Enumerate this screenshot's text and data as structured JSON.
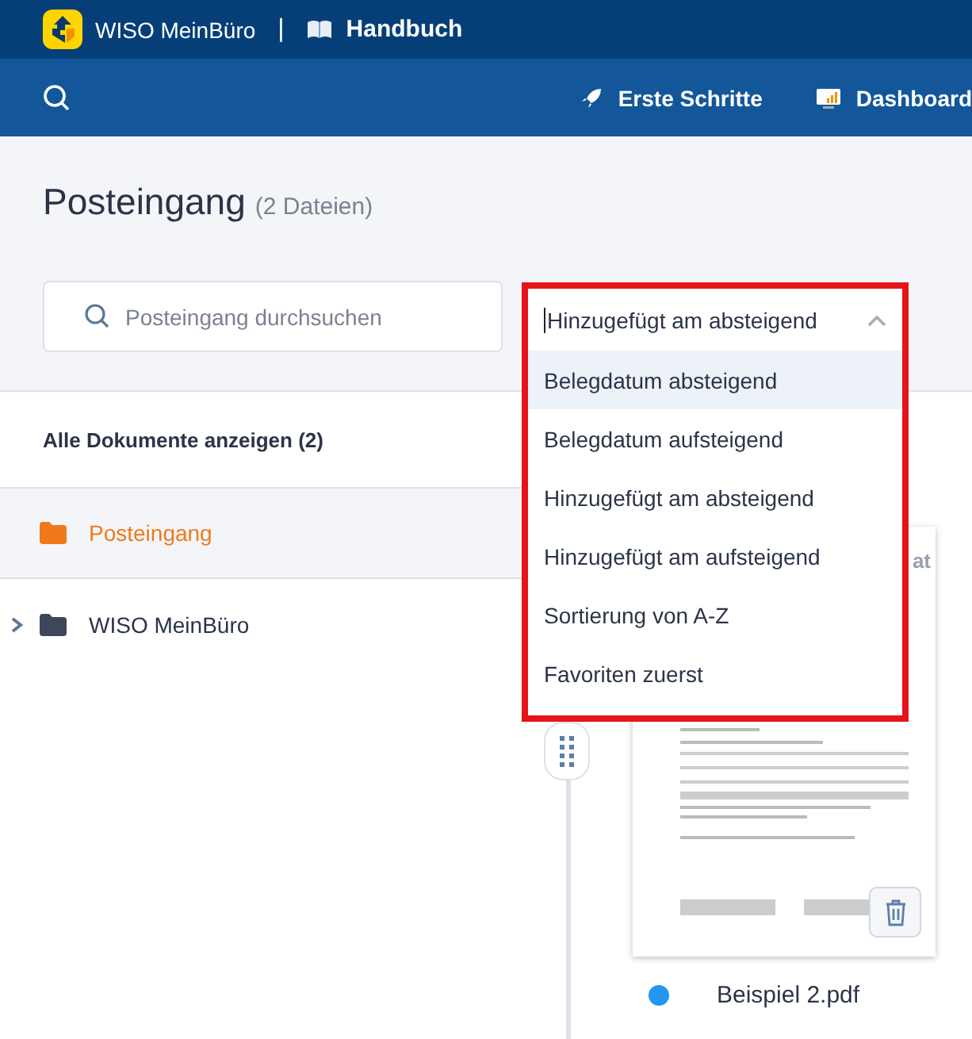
{
  "header": {
    "brand": "WISO MeinBüro",
    "separator": "|",
    "section": "Handbuch"
  },
  "nav": {
    "items": [
      {
        "label": "Erste Schritte",
        "kind": "rocket"
      },
      {
        "label": "Dashboard",
        "kind": "chart"
      }
    ]
  },
  "page": {
    "title": "Posteingang",
    "count": "(2 Dateien)"
  },
  "search": {
    "placeholder": "Posteingang durchsuchen"
  },
  "sort": {
    "value": "Hinzugefügt am absteigend",
    "expanded": true,
    "options": [
      {
        "label": "Belegdatum absteigend",
        "highlighted": true
      },
      {
        "label": "Belegdatum aufsteigend",
        "highlighted": false
      },
      {
        "label": "Hinzugefügt am absteigend",
        "highlighted": false
      },
      {
        "label": "Hinzugefügt am aufsteigend",
        "highlighted": false
      },
      {
        "label": "Sortierung von A-Z",
        "highlighted": false
      },
      {
        "label": "Favoriten zuerst",
        "highlighted": false
      }
    ]
  },
  "sidebar": {
    "show_all": "Alle Dokumente anzeigen (2)",
    "folders": [
      {
        "label": "Posteingang",
        "selected": true,
        "expandable": false
      },
      {
        "label": "WISO MeinBüro",
        "selected": false,
        "expandable": true
      }
    ]
  },
  "documents": [
    {
      "name": "Beispiel 2.pdf",
      "preview_label": "at",
      "color": "#2196f3"
    }
  ]
}
